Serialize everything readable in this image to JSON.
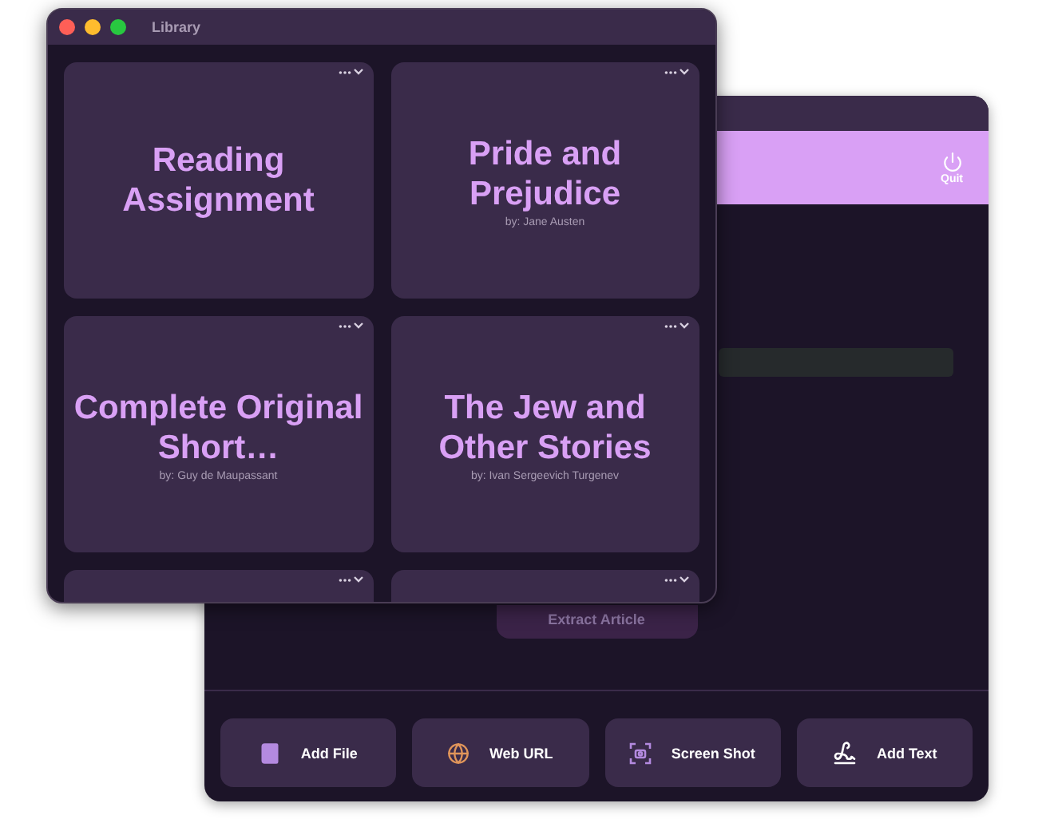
{
  "back_window": {
    "quit_label": "Quit",
    "extract_button": {
      "label": "Extract Article",
      "disabled": true
    },
    "actions": [
      {
        "kind": "file",
        "label": "Add File"
      },
      {
        "kind": "web",
        "label": "Web URL"
      },
      {
        "kind": "screenshot",
        "label": "Screen Shot"
      },
      {
        "kind": "text",
        "label": "Add Text"
      }
    ]
  },
  "library_window": {
    "title": "Library",
    "books": [
      {
        "kind": "book",
        "title": "Reading Assignment"
      },
      {
        "kind": "book",
        "title": "Pride and Prejudice",
        "author": "by: Jane Austen"
      },
      {
        "kind": "book",
        "title": "Complete Original Short…",
        "author": "by: Guy de Maupassant"
      },
      {
        "kind": "book",
        "title": "The Jew and Other Stories",
        "author": "by: Ivan Sergeevich Turgenev"
      },
      {
        "kind": "cut-off"
      },
      {
        "kind": "cut-off"
      }
    ]
  }
}
